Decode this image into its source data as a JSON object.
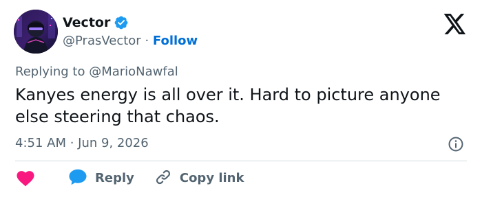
{
  "author": {
    "display_name": "Vector",
    "handle": "@PrasVector",
    "separator": " · ",
    "follow_label": "Follow",
    "verified": true
  },
  "reply_context": {
    "prefix": "Replying to ",
    "target": "@MarioNawfal"
  },
  "tweet": {
    "text": "Kanyes energy is all over it. Hard to picture anyone else steering that chaos.",
    "timestamp": "4:51 AM · Jun 9, 2026"
  },
  "actions": {
    "reply_label": "Reply",
    "copy_link_label": "Copy link"
  },
  "icons": {
    "like": "heart-icon",
    "reply": "speech-bubble-icon",
    "copy": "link-icon",
    "info": "info-icon",
    "brand": "x-logo-icon",
    "verified": "verified-badge-icon"
  },
  "colors": {
    "like": "#f91880",
    "reply": "#1d9bf0",
    "link": "#006fd6",
    "verified": "#1d9bf0",
    "muted": "#536471",
    "text": "#0f1419"
  }
}
